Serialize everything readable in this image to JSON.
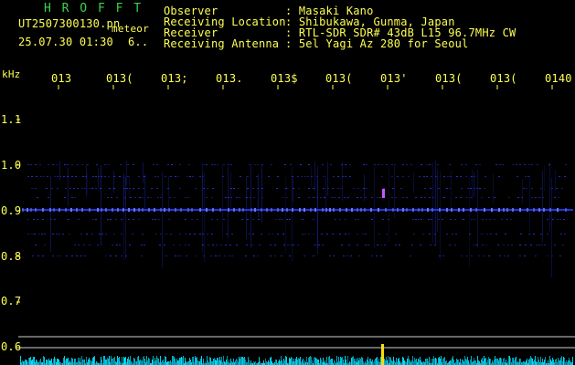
{
  "header": {
    "logo": "H R O F F T",
    "filename": "UT2507300130.pn",
    "tag": "meteor",
    "datetime": "25.07.30 01:30",
    "extra": "6..",
    "fields": [
      {
        "label": "Observer",
        "value": ": Masaki Kano"
      },
      {
        "label": "Receiving Location",
        "value": ": Shibukawa, Gunma, Japan"
      },
      {
        "label": "Receiver",
        "value": ": RTL-SDR SDR# 43dB L15 96.7MHz CW"
      },
      {
        "label": "Receiving Antenna",
        "value": ": 5el Yagi Az 280 for Seoul"
      }
    ]
  },
  "axis": {
    "unit": "kHz",
    "time_ticks": [
      "013",
      "013(",
      "013;",
      "013.",
      "013$",
      "013(",
      "013'",
      "013(",
      "013(",
      "0140"
    ],
    "freq_ticks": [
      "1.1",
      "1.0",
      "0.9",
      "0.8",
      "0.7",
      "0.6"
    ]
  },
  "colors": {
    "text": "#ffff55",
    "logo": "#3cd24a",
    "signal": "#2a3cff",
    "spike": "#ffdd00",
    "noise_floor": "#00e0ff",
    "grid": "#cfcfcf"
  }
}
